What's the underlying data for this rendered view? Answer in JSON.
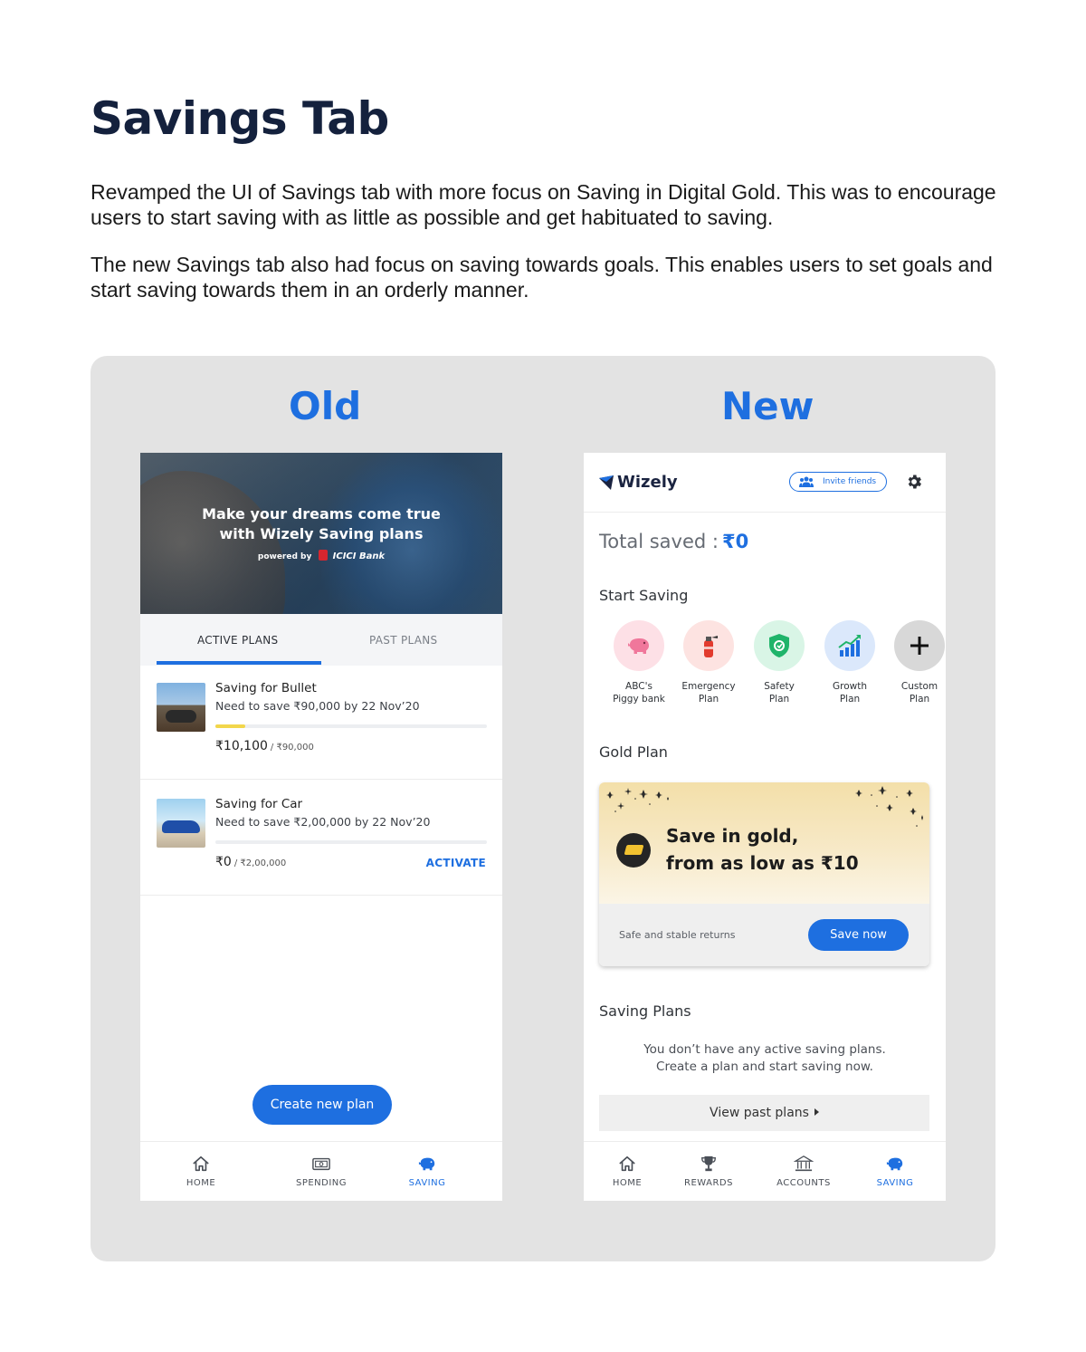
{
  "page": {
    "title": "Savings Tab",
    "paragraphs": [
      "Revamped the UI of Savings tab with more focus on Saving in Digital Gold. This was to encourage users to start saving with as little as possible and get habituated to saving.",
      "The new Savings tab also had focus on saving towards goals. This enables users to set goals and start saving towards them in an orderly manner."
    ]
  },
  "old": {
    "label": "Old",
    "hero": {
      "line1": "Make your dreams come true",
      "line2": "with Wizely Saving plans",
      "powered": "powered by",
      "bank": "ICICI Bank"
    },
    "tabs": {
      "active": "ACTIVE PLANS",
      "past": "PAST PLANS"
    },
    "plans": [
      {
        "name": "Saving for Bullet",
        "subtitle": "Need to save ₹90,000 by 22 Nov’20",
        "saved": "₹10,100",
        "target": "/ ₹90,000",
        "progress": 0.11
      },
      {
        "name": "Saving for Car",
        "subtitle": "Need to save ₹2,00,000 by 22 Nov’20",
        "saved": "₹0",
        "target": "/ ₹2,00,000",
        "progress": 0,
        "action": "ACTIVATE"
      }
    ],
    "create_button": "Create new plan",
    "nav": [
      {
        "label": "HOME",
        "icon": "home-icon"
      },
      {
        "label": "SPENDING",
        "icon": "wallet-icon"
      },
      {
        "label": "SAVING",
        "icon": "piggy-bank-icon",
        "active": true
      }
    ]
  },
  "new": {
    "label": "New",
    "brand": "Wizely",
    "invite": "Invite friends",
    "total_label": "Total saved :",
    "total_value": "₹0",
    "start_saving_title": "Start Saving",
    "goals": [
      {
        "line1": "ABC's",
        "line2": "Piggy bank",
        "icon": "piggy-bank-icon",
        "color": "#fde0e6"
      },
      {
        "line1": "Emergency",
        "line2": "Plan",
        "icon": "fire-extinguisher-icon",
        "color": "#fde3e1"
      },
      {
        "line1": "Safety",
        "line2": "Plan",
        "icon": "shield-icon",
        "color": "#d9f5e6"
      },
      {
        "line1": "Growth",
        "line2": "Plan",
        "icon": "growth-chart-icon",
        "color": "#dbe8fb"
      },
      {
        "line1": "Custom",
        "line2": "Plan",
        "icon": "plus-icon",
        "color": "#d8d8d8"
      }
    ],
    "gold_title": "Gold Plan",
    "gold": {
      "line1": "Save in gold,",
      "line2": "from as low as ₹10",
      "caption": "Safe and stable returns",
      "button": "Save now"
    },
    "plans_title": "Saving Plans",
    "empty_line1": "You don’t have any active saving plans.",
    "empty_line2": "Create a plan and start saving now.",
    "past_button": "View past plans",
    "nav": [
      {
        "label": "HOME",
        "icon": "home-icon"
      },
      {
        "label": "REWARDS",
        "icon": "trophy-icon"
      },
      {
        "label": "ACCOUNTS",
        "icon": "bank-icon"
      },
      {
        "label": "SAVING",
        "icon": "piggy-bank-icon",
        "active": true
      }
    ]
  },
  "colors": {
    "accent": "#1e6fe0",
    "heading": "#14213d",
    "stage": "#e3e3e3",
    "progress": "#f2d64b"
  }
}
